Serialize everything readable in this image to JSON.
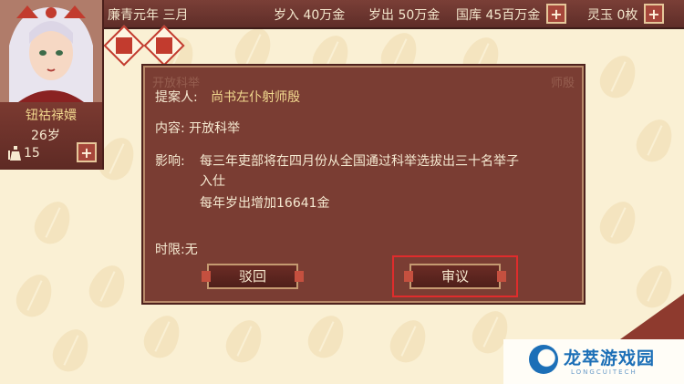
{
  "topbar": {
    "date": "廉青元年 三月",
    "income": "岁入 40万金",
    "expense": "岁出 50万金",
    "treasury": "国库 45百万金",
    "jade": "灵玉 0枚",
    "plus_label": "+"
  },
  "character": {
    "name": "钮祜禄嬛",
    "age": "26岁",
    "stat_value": "15",
    "plus_label": "+",
    "stat_icon": "soldier-icon"
  },
  "seals": [
    "seal-icon",
    "seal-icon"
  ],
  "dialog": {
    "title": "开放科举",
    "side_label": "师殷",
    "proposer_label": "提案人:",
    "proposer_name": "尚书左仆射师殷",
    "content_label": "内容:",
    "content_value": "开放科举",
    "effect_label": "影响:",
    "effect_line1": "每三年吏部将在四月份从全国通过科举选拔出三十名举子",
    "effect_line2": "入仕",
    "effect_line3": "每年岁出增加16641金",
    "deadline": "时限:无",
    "reject_button": "驳回",
    "review_button": "审议"
  },
  "watermark": {
    "title": "龙萃游戏园",
    "subtitle": "LONGCUITECH"
  },
  "colors": {
    "panel": "#7a3d33",
    "accent_red": "#c23b2e",
    "highlight": "#e02c2c",
    "background": "#faf0d4"
  }
}
